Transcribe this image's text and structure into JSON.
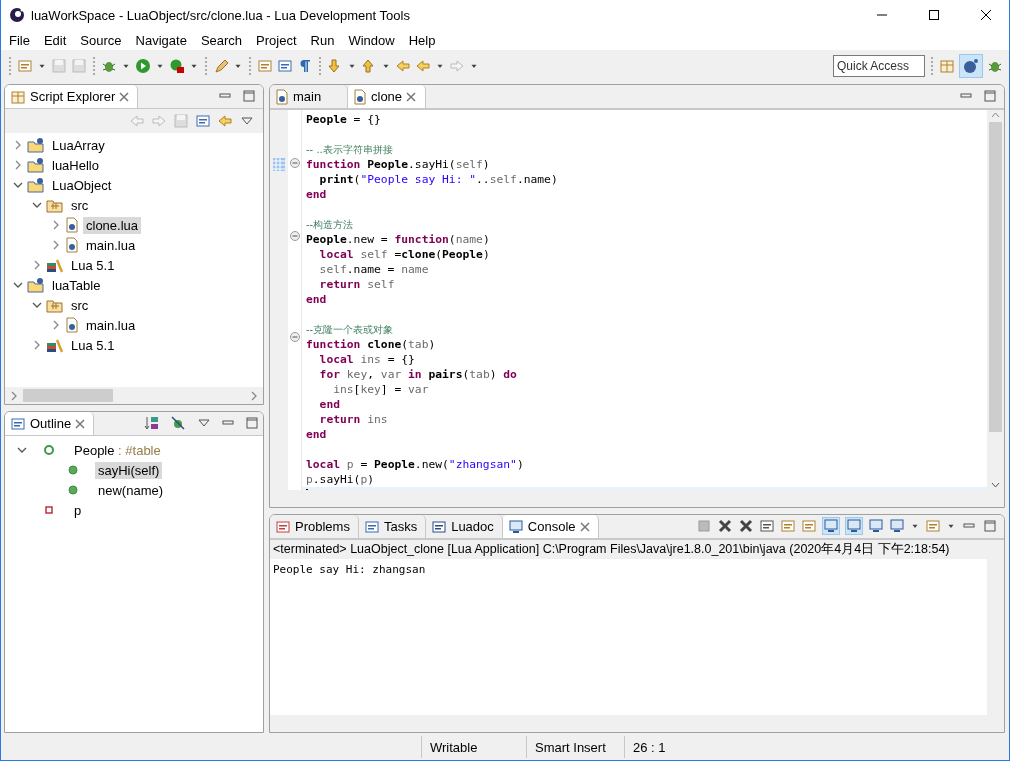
{
  "window": {
    "title": "luaWorkSpace - LuaObject/src/clone.lua - Lua Development Tools"
  },
  "menu": [
    "File",
    "Edit",
    "Source",
    "Navigate",
    "Search",
    "Project",
    "Run",
    "Window",
    "Help"
  ],
  "quick_access": {
    "placeholder": "Quick Access"
  },
  "script_explorer": {
    "title": "Script Explorer",
    "tree": [
      {
        "label": "LuaArray",
        "kind": "project",
        "expanded": false,
        "selected": false
      },
      {
        "label": "luaHello",
        "kind": "project",
        "expanded": false,
        "selected": false
      },
      {
        "label": "LuaObject",
        "kind": "project",
        "expanded": true,
        "selected": false,
        "children": [
          {
            "label": "src",
            "kind": "folder",
            "expanded": true,
            "selected": false,
            "children": [
              {
                "label": "clone.lua",
                "kind": "file",
                "expanded": false,
                "selected": true
              },
              {
                "label": "main.lua",
                "kind": "file",
                "expanded": false,
                "selected": false
              }
            ]
          },
          {
            "label": "Lua 5.1",
            "kind": "library",
            "expanded": false,
            "selected": false
          }
        ]
      },
      {
        "label": "luaTable",
        "kind": "project",
        "expanded": true,
        "selected": false,
        "children": [
          {
            "label": "src",
            "kind": "folder",
            "expanded": true,
            "selected": false,
            "children": [
              {
                "label": "main.lua",
                "kind": "file",
                "expanded": false,
                "selected": false
              }
            ]
          },
          {
            "label": "Lua 5.1",
            "kind": "library",
            "expanded": false,
            "selected": false
          }
        ]
      }
    ]
  },
  "outline": {
    "title": "Outline",
    "items": [
      {
        "label": "People",
        "type": " : #table",
        "kind": "table",
        "expanded": true,
        "selected": false,
        "children": [
          {
            "label": "sayHi(self)",
            "kind": "method",
            "selected": true
          },
          {
            "label": "new(name)",
            "kind": "method",
            "selected": false
          }
        ]
      },
      {
        "label": "p",
        "kind": "variable",
        "selected": false
      }
    ]
  },
  "editor": {
    "tabs": [
      {
        "label": "main",
        "selected": false
      },
      {
        "label": "clone",
        "selected": true
      }
    ],
    "lines": [
      {
        "fold": false,
        "current": false,
        "tokens": [
          {
            "kind": "global",
            "text": "People"
          },
          {
            "kind": "plain",
            "text": " = {}"
          }
        ]
      },
      {
        "fold": false,
        "current": false
      },
      {
        "fold": false,
        "current": false,
        "tokens": [
          {
            "kind": "comment",
            "text": "-- ..表示字符串拼接"
          }
        ]
      },
      {
        "fold": true,
        "current": false,
        "tokens": [
          {
            "kind": "keyword",
            "text": "function"
          },
          {
            "kind": "global",
            "text": " People"
          },
          {
            "kind": "plain",
            "text": ".sayHi("
          },
          {
            "kind": "local",
            "text": "self"
          },
          {
            "kind": "plain",
            "text": ")"
          }
        ]
      },
      {
        "fold": false,
        "current": false,
        "tokens": [
          {
            "kind": "global",
            "text": "  print"
          },
          {
            "kind": "plain",
            "text": "("
          },
          {
            "kind": "string",
            "text": "\"People say Hi: \""
          },
          {
            "kind": "plain",
            "text": ".."
          },
          {
            "kind": "local",
            "text": "self"
          },
          {
            "kind": "plain",
            "text": ".name)"
          }
        ]
      },
      {
        "fold": false,
        "current": false,
        "tokens": [
          {
            "kind": "keyword",
            "text": "end"
          }
        ]
      },
      {
        "fold": false,
        "current": false
      },
      {
        "fold": false,
        "current": false,
        "tokens": [
          {
            "kind": "comment",
            "text": "--构造方法"
          }
        ]
      },
      {
        "fold": true,
        "current": false,
        "tokens": [
          {
            "kind": "global",
            "text": "People"
          },
          {
            "kind": "plain",
            "text": ".new = "
          },
          {
            "kind": "keyword",
            "text": "function"
          },
          {
            "kind": "plain",
            "text": "("
          },
          {
            "kind": "local",
            "text": "name"
          },
          {
            "kind": "plain",
            "text": ")"
          }
        ]
      },
      {
        "fold": false,
        "current": false,
        "tokens": [
          {
            "kind": "keyword",
            "text": "  local"
          },
          {
            "kind": "local",
            "text": " self"
          },
          {
            "kind": "plain",
            "text": " ="
          },
          {
            "kind": "global",
            "text": "clone"
          },
          {
            "kind": "plain",
            "text": "("
          },
          {
            "kind": "global",
            "text": "People"
          },
          {
            "kind": "plain",
            "text": ")"
          }
        ]
      },
      {
        "fold": false,
        "current": false,
        "tokens": [
          {
            "kind": "local",
            "text": "  self"
          },
          {
            "kind": "plain",
            "text": ".name = "
          },
          {
            "kind": "local",
            "text": "name"
          }
        ]
      },
      {
        "fold": false,
        "current": false,
        "tokens": [
          {
            "kind": "keyword",
            "text": "  return"
          },
          {
            "kind": "local",
            "text": " self"
          }
        ]
      },
      {
        "fold": false,
        "current": false,
        "tokens": [
          {
            "kind": "keyword",
            "text": "end"
          }
        ]
      },
      {
        "fold": false,
        "current": false
      },
      {
        "fold": false,
        "current": false,
        "tokens": [
          {
            "kind": "comment",
            "text": "--克隆一个表或对象"
          }
        ]
      },
      {
        "fold": true,
        "current": false,
        "tokens": [
          {
            "kind": "keyword",
            "text": "function"
          },
          {
            "kind": "global",
            "text": " clone"
          },
          {
            "kind": "plain",
            "text": "("
          },
          {
            "kind": "local",
            "text": "tab"
          },
          {
            "kind": "plain",
            "text": ")"
          }
        ]
      },
      {
        "fold": false,
        "current": false,
        "tokens": [
          {
            "kind": "keyword",
            "text": "  local"
          },
          {
            "kind": "local",
            "text": " ins"
          },
          {
            "kind": "plain",
            "text": " = {}"
          }
        ]
      },
      {
        "fold": false,
        "current": false,
        "tokens": [
          {
            "kind": "keyword",
            "text": "  for"
          },
          {
            "kind": "local",
            "text": " key"
          },
          {
            "kind": "plain",
            "text": ", "
          },
          {
            "kind": "local",
            "text": "var"
          },
          {
            "kind": "keyword",
            "text": " in"
          },
          {
            "kind": "global",
            "text": " pairs"
          },
          {
            "kind": "plain",
            "text": "("
          },
          {
            "kind": "local",
            "text": "tab"
          },
          {
            "kind": "plain",
            "text": ") "
          },
          {
            "kind": "keyword",
            "text": "do"
          }
        ]
      },
      {
        "fold": false,
        "current": false,
        "tokens": [
          {
            "kind": "local",
            "text": "    ins"
          },
          {
            "kind": "plain",
            "text": "["
          },
          {
            "kind": "local",
            "text": "key"
          },
          {
            "kind": "plain",
            "text": "] = "
          },
          {
            "kind": "local",
            "text": "var"
          }
        ]
      },
      {
        "fold": false,
        "current": false,
        "tokens": [
          {
            "kind": "keyword",
            "text": "  end"
          }
        ]
      },
      {
        "fold": false,
        "current": false,
        "tokens": [
          {
            "kind": "keyword",
            "text": "  return"
          },
          {
            "kind": "local",
            "text": " ins"
          }
        ]
      },
      {
        "fold": false,
        "current": false,
        "tokens": [
          {
            "kind": "keyword",
            "text": "end"
          }
        ]
      },
      {
        "fold": false,
        "current": false
      },
      {
        "fold": false,
        "current": false,
        "tokens": [
          {
            "kind": "keyword",
            "text": "local"
          },
          {
            "kind": "local",
            "text": " p"
          },
          {
            "kind": "plain",
            "text": " = "
          },
          {
            "kind": "global",
            "text": "People"
          },
          {
            "kind": "plain",
            "text": ".new("
          },
          {
            "kind": "string",
            "text": "\"zhangsan\""
          },
          {
            "kind": "plain",
            "text": ")"
          }
        ]
      },
      {
        "fold": false,
        "current": false,
        "tokens": [
          {
            "kind": "local",
            "text": "p"
          },
          {
            "kind": "plain",
            "text": ".sayHi("
          },
          {
            "kind": "local",
            "text": "p"
          },
          {
            "kind": "plain",
            "text": ")"
          }
        ]
      },
      {
        "fold": false,
        "current": true
      }
    ]
  },
  "console": {
    "tabs": [
      {
        "label": "Problems",
        "kind": "problems",
        "selected": false
      },
      {
        "label": "Tasks",
        "kind": "tasks",
        "selected": false
      },
      {
        "label": "Luadoc",
        "kind": "luadoc",
        "selected": false
      },
      {
        "label": "Console",
        "kind": "console",
        "selected": true
      }
    ],
    "header": "<terminated> LuaObject_clone [Lua Application] C:\\Program Files\\Java\\jre1.8.0_201\\bin\\java (2020年4月4日 下午2:18:54)",
    "output": "People say Hi: zhangsan"
  },
  "status_bar": [
    "Writable",
    "Smart Insert",
    "26 : 1"
  ]
}
